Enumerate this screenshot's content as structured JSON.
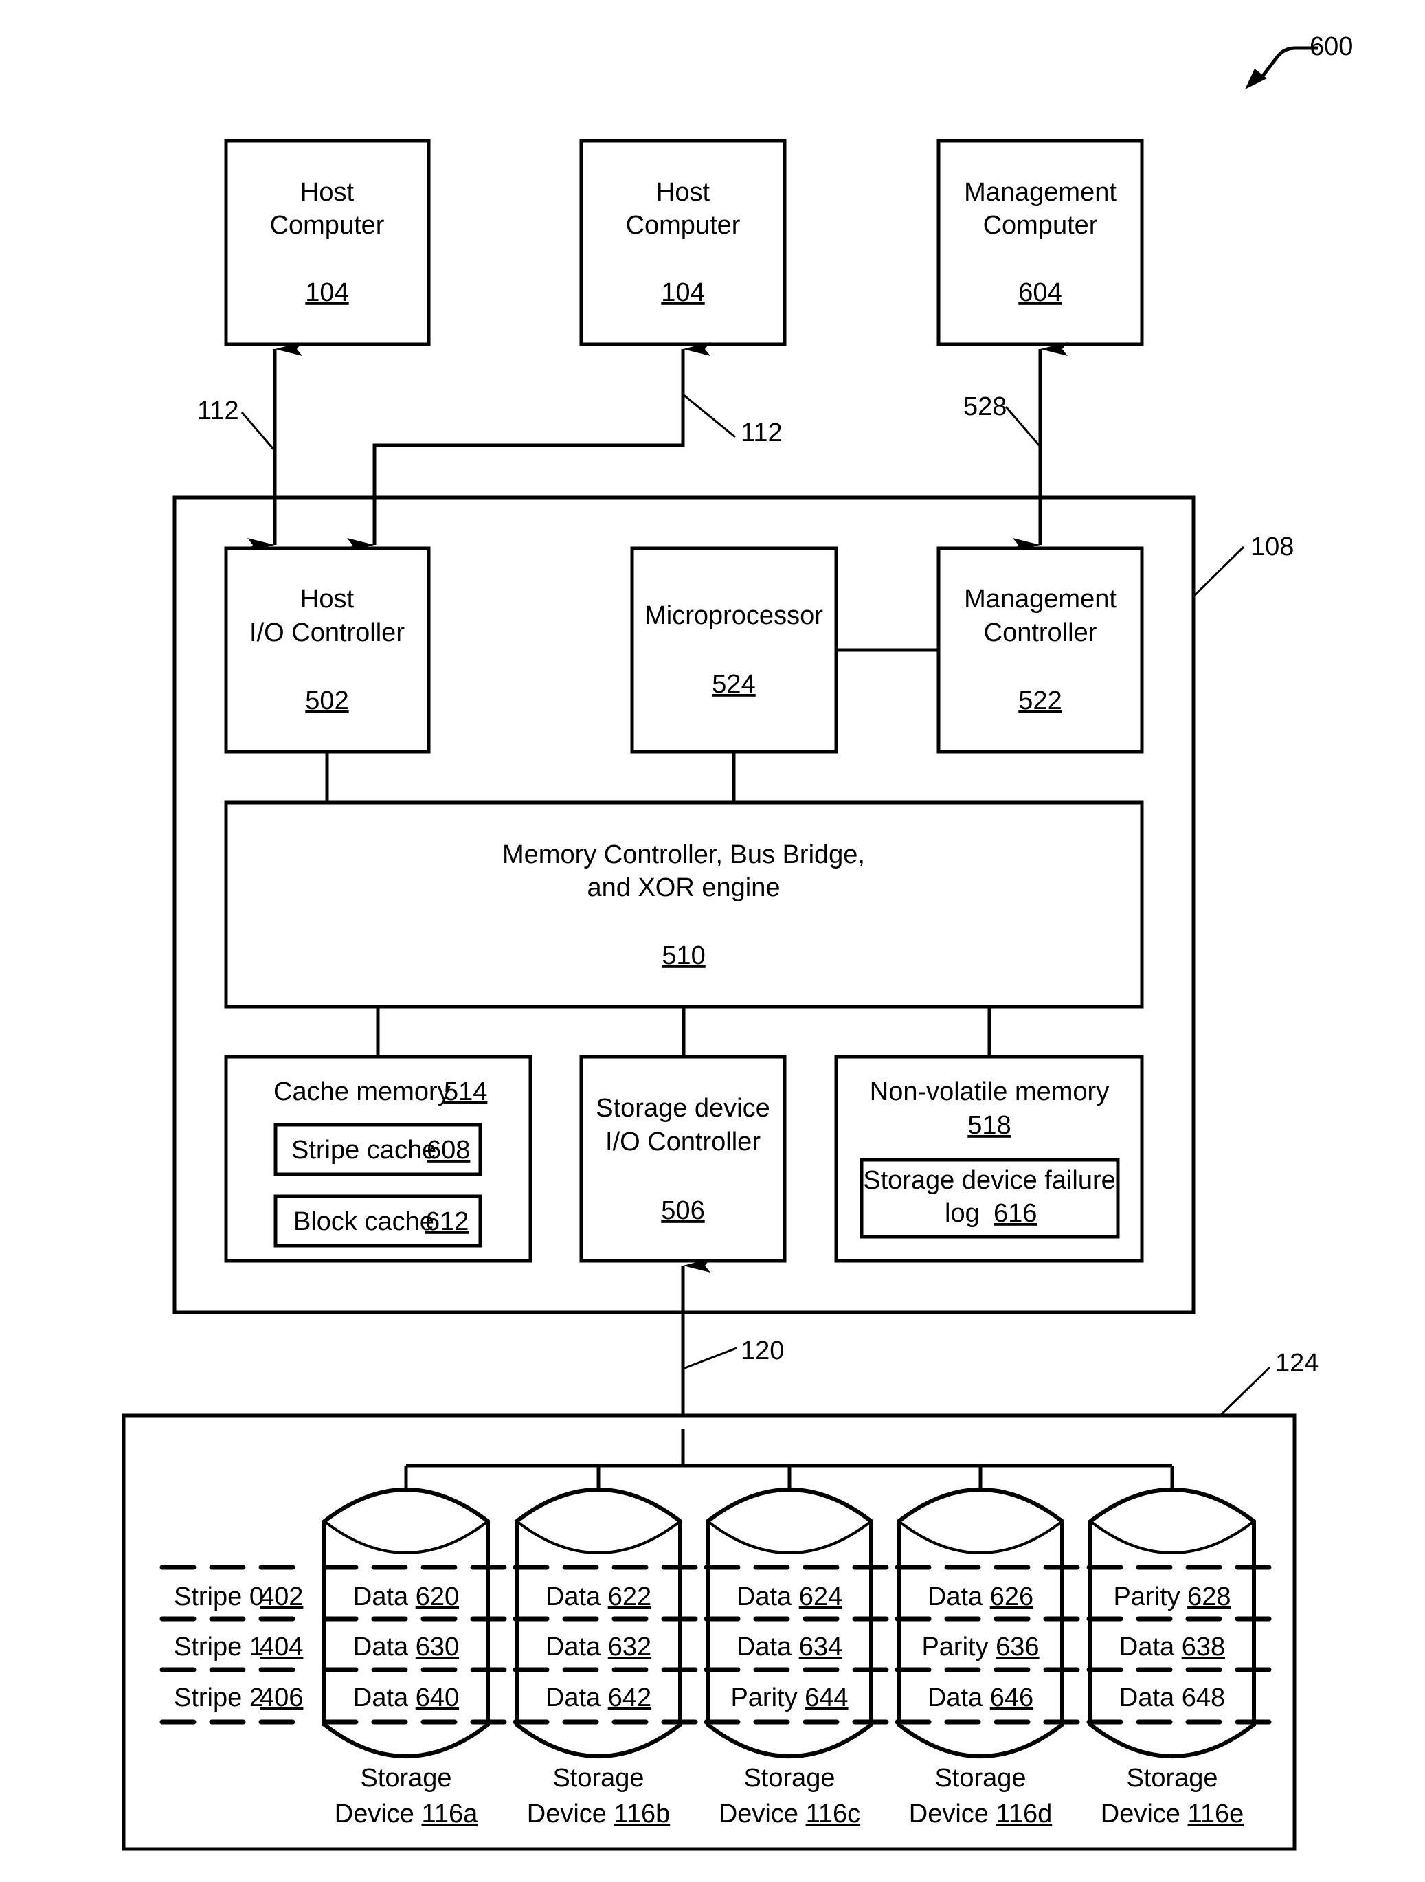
{
  "figure": {
    "ref": "600",
    "container_ref": "108",
    "storage_array_ref": "124"
  },
  "links": {
    "host_link_left": "112",
    "host_link_right": "112",
    "management_link": "528",
    "storage_link": "120"
  },
  "top_boxes": [
    {
      "line1": "Host",
      "line2": "Computer",
      "ref": "104"
    },
    {
      "line1": "Host",
      "line2": "Computer",
      "ref": "104"
    },
    {
      "line1": "Management",
      "line2": "Computer",
      "ref": "604"
    }
  ],
  "controllers": {
    "host_io": {
      "line1": "Host",
      "line2": "I/O Controller",
      "ref": "502"
    },
    "microprocessor": {
      "line1": "Microprocessor",
      "ref": "524"
    },
    "management": {
      "line1": "Management",
      "line2": "Controller",
      "ref": "522"
    }
  },
  "memory_controller": {
    "line1": "Memory Controller, Bus Bridge,",
    "line2": "and XOR engine",
    "ref": "510"
  },
  "cache_memory": {
    "label": "Cache memory",
    "ref": "514",
    "stripe_cache": {
      "label": "Stripe cache",
      "ref": "608"
    },
    "block_cache": {
      "label": "Block cache",
      "ref": "612"
    }
  },
  "storage_io_controller": {
    "line1": "Storage device",
    "line2": "I/O Controller",
    "ref": "506"
  },
  "nvm": {
    "label": "Non-volatile memory",
    "ref": "518",
    "failure_log": {
      "line1": "Storage device failure",
      "line2": "log",
      "ref": "616"
    }
  },
  "stripes": [
    {
      "label": "Stripe 0",
      "ref": "402"
    },
    {
      "label": "Stripe 1",
      "ref": "404"
    },
    {
      "label": "Stripe 2",
      "ref": "406"
    }
  ],
  "devices": [
    {
      "line1": "Storage",
      "line2": "Device",
      "ref": "116a",
      "blocks": [
        {
          "kind": "Data",
          "ref": "620"
        },
        {
          "kind": "Data",
          "ref": "630"
        },
        {
          "kind": "Data",
          "ref": "640"
        }
      ]
    },
    {
      "line1": "Storage",
      "line2": "Device",
      "ref": "116b",
      "blocks": [
        {
          "kind": "Data",
          "ref": "622"
        },
        {
          "kind": "Data",
          "ref": "632"
        },
        {
          "kind": "Data",
          "ref": "642"
        }
      ]
    },
    {
      "line1": "Storage",
      "line2": "Device",
      "ref": "116c",
      "blocks": [
        {
          "kind": "Data",
          "ref": "624"
        },
        {
          "kind": "Data",
          "ref": "634"
        },
        {
          "kind": "Parity",
          "ref": "644"
        }
      ]
    },
    {
      "line1": "Storage",
      "line2": "Device",
      "ref": "116d",
      "blocks": [
        {
          "kind": "Data",
          "ref": "626"
        },
        {
          "kind": "Parity",
          "ref": "636"
        },
        {
          "kind": "Data",
          "ref": "646"
        }
      ]
    },
    {
      "line1": "Storage",
      "line2": "Device",
      "ref": "116e",
      "blocks": [
        {
          "kind": "Parity",
          "ref": "628"
        },
        {
          "kind": "Data",
          "ref": "638"
        },
        {
          "kind": "Data",
          "ref": "648"
        }
      ]
    }
  ]
}
